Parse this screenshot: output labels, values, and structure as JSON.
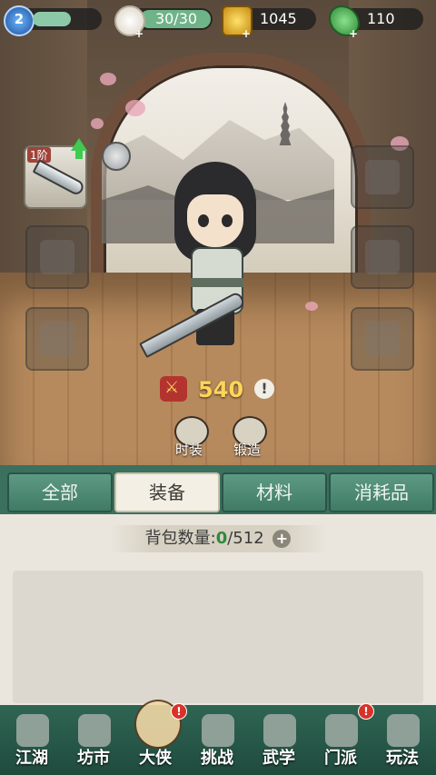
{
  "resources": {
    "level": "2",
    "stamina": "30/30",
    "coins": "1045",
    "jade": "110",
    "plus_glyph": "+"
  },
  "equipment": {
    "weapon_tier": "1阶"
  },
  "power": {
    "value": "540",
    "info_glyph": "!"
  },
  "actions": {
    "costume_label": "时装",
    "forge_label": "锻造"
  },
  "tabs": [
    "全部",
    "装备",
    "材料",
    "消耗品"
  ],
  "active_tab": "装备",
  "bag": {
    "label": "背包数量:",
    "count": "0",
    "capacity": "/512",
    "plus_glyph": "+"
  },
  "nav": [
    {
      "label": "江湖"
    },
    {
      "label": "坊市"
    },
    {
      "label": "大侠"
    },
    {
      "label": "挑战"
    },
    {
      "label": "武学"
    },
    {
      "label": "门派"
    },
    {
      "label": "玩法"
    }
  ],
  "badge_glyph": "!"
}
